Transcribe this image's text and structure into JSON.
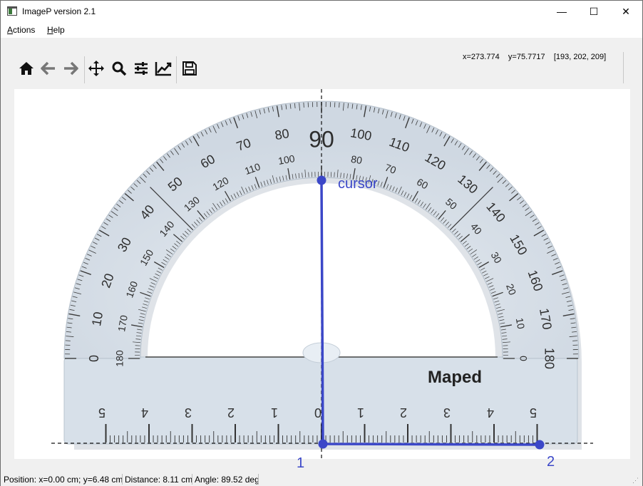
{
  "window": {
    "title": "ImageP version 2.1",
    "minimize": "—",
    "maximize": "☐",
    "close": "✕"
  },
  "menu": {
    "actions": "Actions",
    "help": "Help"
  },
  "toolbar": {
    "tools": [
      "home-icon",
      "back-arrow-icon",
      "forward-arrow-icon",
      "pan-icon",
      "zoom-icon",
      "configure-subplots-icon",
      "edit-axis-icon",
      "save-icon"
    ],
    "coords": "x=273.774    y=75.7717    [193, 202, 209]"
  },
  "protractor": {
    "outer_ticks": [
      "0",
      "10",
      "20",
      "30",
      "40",
      "50",
      "60",
      "70",
      "80",
      "90",
      "100",
      "110",
      "120",
      "130",
      "140",
      "150",
      "160",
      "170",
      "180"
    ],
    "inner_ticks": [
      "180",
      "170",
      "160",
      "150",
      "140",
      "130",
      "120",
      "110",
      "100",
      "80",
      "70",
      "60",
      "50",
      "40",
      "30",
      "20",
      "10",
      "0"
    ],
    "ruler_left": [
      "5",
      "4",
      "3",
      "2",
      "1",
      "0"
    ],
    "ruler_right": [
      "1",
      "2",
      "3",
      "4",
      "5"
    ],
    "brand": "Maped"
  },
  "overlay": {
    "cursor_label": "cursor",
    "point1_label": "1",
    "point2_label": "2",
    "line_color": "#3b47c8"
  },
  "status": {
    "position": "Position: x=0.00 cm; y=6.48 cm",
    "distance": "Distance: 8.11 cm",
    "angle": "Angle: 89.52 deg"
  }
}
